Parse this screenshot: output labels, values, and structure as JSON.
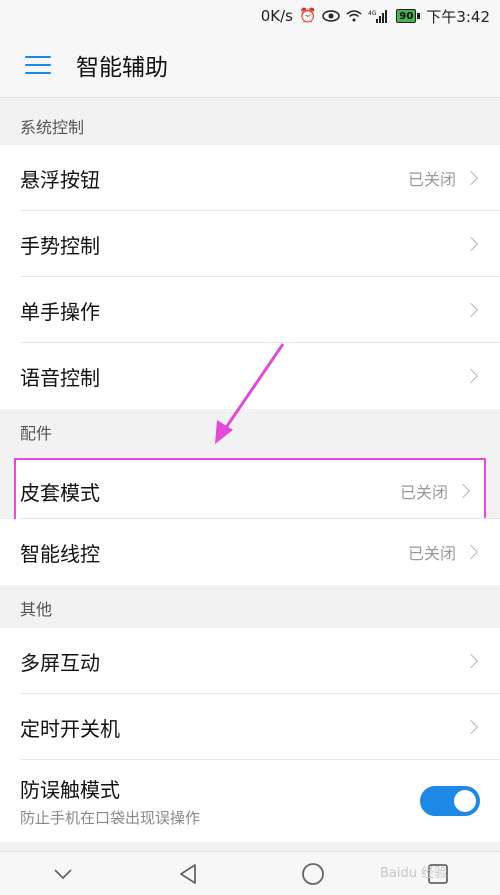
{
  "status_bar": {
    "speed": "0K/s",
    "network": "4G",
    "battery": "90",
    "time": "下午3:42"
  },
  "appbar": {
    "title": "智能辅助"
  },
  "sections": {
    "system": {
      "header": "系统控制",
      "items": [
        {
          "label": "悬浮按钮",
          "status": "已关闭"
        },
        {
          "label": "手势控制",
          "status": ""
        },
        {
          "label": "单手操作",
          "status": ""
        },
        {
          "label": "语音控制",
          "status": ""
        }
      ]
    },
    "accessories": {
      "header": "配件",
      "items": [
        {
          "label": "皮套模式",
          "status": "已关闭"
        },
        {
          "label": "智能线控",
          "status": "已关闭"
        }
      ]
    },
    "other": {
      "header": "其他",
      "items": [
        {
          "label": "多屏互动",
          "status": ""
        },
        {
          "label": "定时开关机",
          "status": ""
        }
      ],
      "toggle_item": {
        "label": "防误触模式",
        "subtitle": "防止手机在口袋出现误操作",
        "enabled": true
      }
    }
  },
  "annotation_color": "#e24bd7",
  "accent_color": "#1e88e5",
  "watermark": "Baidu 经验"
}
